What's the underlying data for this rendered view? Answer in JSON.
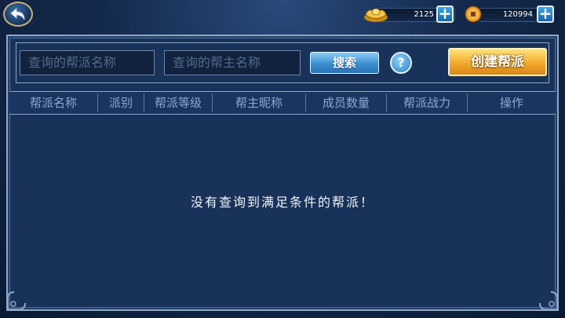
{
  "currency": {
    "gold": {
      "icon": "gold-ingot-icon",
      "amount": "2125",
      "plus": "+"
    },
    "coin": {
      "icon": "copper-coin-icon",
      "amount": "120994",
      "plus": "+"
    }
  },
  "search": {
    "guild_name_placeholder": "查询的帮派名称",
    "leader_name_placeholder": "查询的帮主名称",
    "search_label": "搜索",
    "help_label": "?",
    "create_label": "创建帮派"
  },
  "table": {
    "columns": [
      "帮派名称",
      "派别",
      "帮派等级",
      "帮主昵称",
      "成员数量",
      "帮派战力",
      "操作"
    ],
    "empty_message": "没有查询到满足条件的帮派！"
  }
}
